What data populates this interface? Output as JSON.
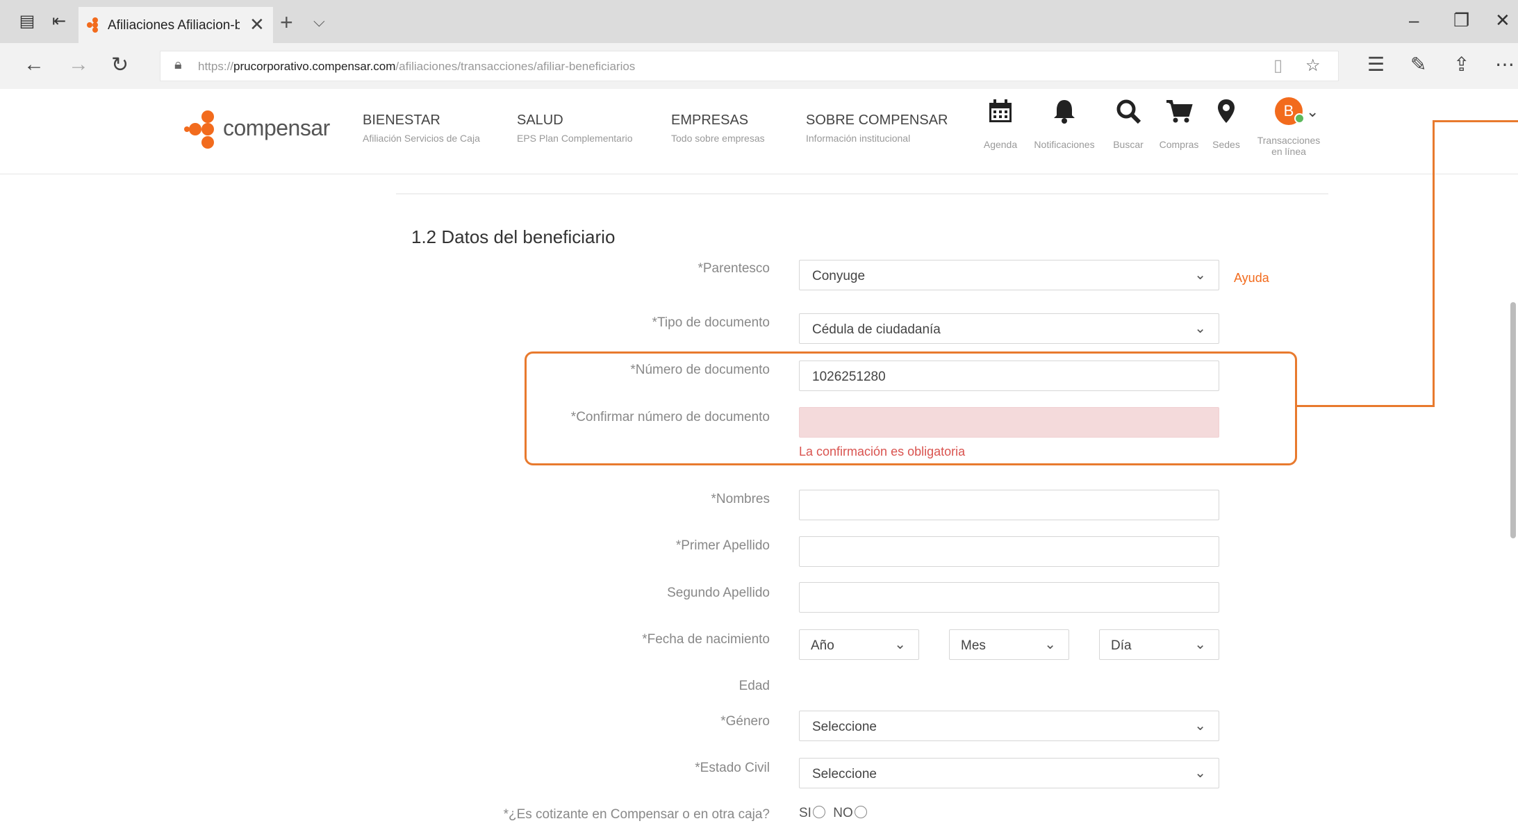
{
  "browser": {
    "tab_title": "Afiliaciones Afiliacion-b",
    "tab_close": "✕",
    "new_tab": "+",
    "tab_menu": "⌵",
    "url_prefix": "https://",
    "url_host": "prucorporativo.compensar.com",
    "url_path": "/afiliaciones/transacciones/afiliar-beneficiarios",
    "icons": [
      "tab-actions-icon",
      "tab-back-icon",
      "back-arrow-icon",
      "forward-arrow-icon",
      "refresh-icon",
      "lock-icon",
      "reading-view-icon",
      "favorite-star-icon",
      "favorites-list-icon",
      "pen-icon",
      "share-icon",
      "more-icon",
      "minimize-icon",
      "restore-icon",
      "close-icon"
    ]
  },
  "site": {
    "logo_text": "compensar",
    "nav": [
      {
        "title": "BIENESTAR",
        "subtitle": "Afiliación Servicios de Caja"
      },
      {
        "title": "SALUD",
        "subtitle": "EPS Plan Complementario"
      },
      {
        "title": "EMPRESAS",
        "subtitle": "Todo sobre empresas"
      },
      {
        "title": "SOBRE COMPENSAR",
        "subtitle": "Información institucional"
      }
    ],
    "header_icons": [
      {
        "icon": "calendar-icon",
        "label": "Agenda"
      },
      {
        "icon": "bell-icon",
        "label": "Notificaciones"
      },
      {
        "icon": "search-icon",
        "label": "Buscar"
      },
      {
        "icon": "cart-icon",
        "label": "Compras"
      },
      {
        "icon": "location-pin-icon",
        "label": "Sedes"
      }
    ],
    "user": {
      "initial": "B",
      "label_line1": "Transacciones",
      "label_line2": "en línea"
    }
  },
  "form": {
    "section_title": "1.2 Datos del beneficiario",
    "help_link": "Ayuda",
    "parentesco": {
      "label": "*Parentesco",
      "value": "Conyuge"
    },
    "tipo_documento": {
      "label": "*Tipo de documento",
      "value": "Cédula de ciudadanía"
    },
    "numero_documento": {
      "label": "*Número de documento",
      "value": "1026251280"
    },
    "confirmar_documento": {
      "label": "*Confirmar número de documento",
      "value": "",
      "error": "La confirmación es obligatoria"
    },
    "nombres": {
      "label": "*Nombres",
      "value": ""
    },
    "primer_apellido": {
      "label": "*Primer Apellido",
      "value": ""
    },
    "segundo_apellido": {
      "label": "Segundo Apellido",
      "value": ""
    },
    "fecha_nacimiento": {
      "label": "*Fecha de nacimiento",
      "year": "Año",
      "month": "Mes",
      "day": "Día"
    },
    "edad": {
      "label": "Edad"
    },
    "genero": {
      "label": "*Género",
      "value": "Seleccione"
    },
    "estado_civil": {
      "label": "*Estado Civil",
      "value": "Seleccione"
    },
    "cotizante": {
      "label": "*¿Es cotizante en Compensar o en otra caja?",
      "yes": "SI",
      "no": "NO"
    }
  },
  "colors": {
    "accent": "#f26b1d",
    "highlight": "#e87a2e",
    "error": "#d9534f",
    "error_bg": "#f4dadb"
  }
}
